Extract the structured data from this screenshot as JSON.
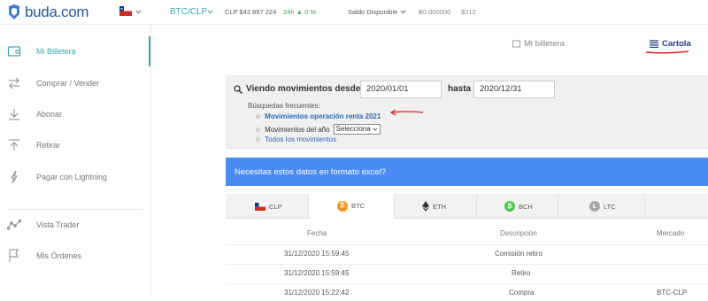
{
  "app": {
    "logo_text": "buda.com",
    "pair": "BTC/CLP",
    "price": "CLP $42 897 224",
    "change": "24h ▲ 0 %",
    "saldo_label": "Saldo Disponible",
    "balance_btc": "Ƀ0,000000",
    "balance_clp": "$312"
  },
  "sidebar": {
    "items": [
      {
        "label": "Mi Billetera",
        "icon": "wallet-icon"
      },
      {
        "label": "Comprar / Vender",
        "icon": "exchange-icon"
      },
      {
        "label": "Abonar",
        "icon": "deposit-icon"
      },
      {
        "label": "Retirar",
        "icon": "withdraw-icon"
      },
      {
        "label": "Pagar con Lightning",
        "icon": "lightning-icon"
      },
      {
        "label": "Vista Trader",
        "icon": "chart-line-icon"
      },
      {
        "label": "Mis Órdenes",
        "icon": "flag-icon"
      }
    ]
  },
  "view_tabs": {
    "billetera": "Mi billetera",
    "cartola": "Cartola"
  },
  "filter": {
    "viendo_label": "Viendo movimientos desde",
    "from_date": "2020/01/01",
    "hasta_label": "hasta",
    "to_date": "2020/12/31",
    "frecuentes_title": "Búsquedas frecuentes:",
    "link_renta": "Movimientos operación renta 2021",
    "movimientos_anio_label": "Movimientos del año",
    "select_value": "Selecciona",
    "todos_link": "Todos los movimientos"
  },
  "excel_banner": "Necesitas estos datos en formato excel?",
  "coin_tabs": [
    {
      "label": "CLP",
      "color": "#d52b1e"
    },
    {
      "label": "BTC",
      "color": "#f7931a"
    },
    {
      "label": "ETH",
      "color": "#333333"
    },
    {
      "label": "BCH",
      "color": "#4cca47"
    },
    {
      "label": "LTC",
      "color": "#a6a6a6"
    }
  ],
  "table": {
    "headers": {
      "fecha": "Fecha",
      "descripcion": "Descripción",
      "mercado": "Mercado"
    },
    "rows": [
      {
        "fecha": "31/12/2020 15:59:45",
        "descripcion": "Comisión retiro",
        "mercado": ""
      },
      {
        "fecha": "31/12/2020 15:59:45",
        "descripcion": "Retiro",
        "mercado": ""
      },
      {
        "fecha": "31/12/2020 15:22:42",
        "descripcion": "Compra",
        "mercado": "BTC-CLP"
      }
    ]
  },
  "colors": {
    "accent": "#38a8b0",
    "brand": "#1e5a9a",
    "banner": "#4a8af4",
    "link": "#2a6ab8"
  }
}
